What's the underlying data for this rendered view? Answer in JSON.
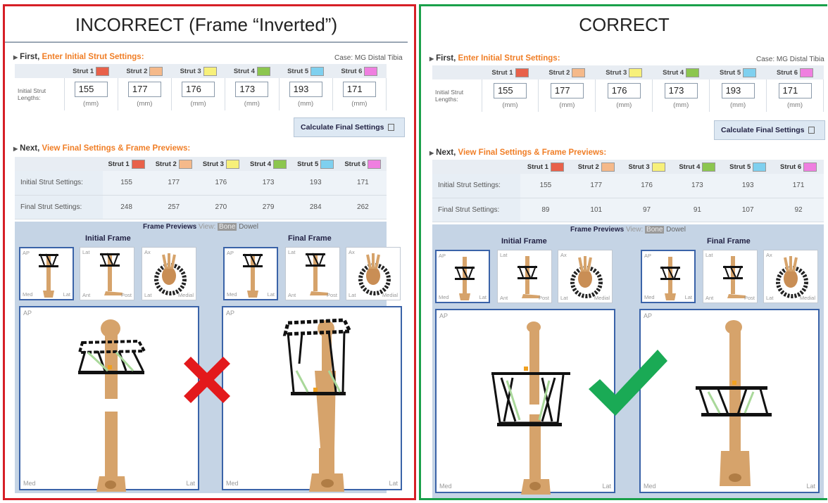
{
  "left": {
    "title": "INCORRECT (Frame “Inverted”)",
    "first_prefix": "First,",
    "first_action": "Enter Initial Strut Settings:",
    "case_label": "Case:",
    "case_value": "MG Distal Tibia",
    "row_label": "Initial Strut Lengths:",
    "struts": [
      {
        "label": "Strut 1",
        "color": "#e8614a",
        "value": "155"
      },
      {
        "label": "Strut 2",
        "color": "#f5b98a",
        "value": "177"
      },
      {
        "label": "Strut 3",
        "color": "#f7f07a",
        "value": "176"
      },
      {
        "label": "Strut 4",
        "color": "#8cc64f",
        "value": "173"
      },
      {
        "label": "Strut 5",
        "color": "#7fd0ef",
        "value": "193"
      },
      {
        "label": "Strut 6",
        "color": "#ef7fe0",
        "value": "171"
      }
    ],
    "unit": "(mm)",
    "calc_button": "Calculate Final Settings",
    "next_prefix": "Next,",
    "next_action": "View Final Settings & Frame Previews:",
    "initial_label": "Initial Strut Settings:",
    "final_label": "Final Strut Settings:",
    "initial_values": [
      "155",
      "177",
      "176",
      "173",
      "193",
      "171"
    ],
    "final_values": [
      "248",
      "257",
      "270",
      "279",
      "284",
      "262"
    ],
    "previews_label": "Frame Previews",
    "view_label": "View:",
    "bone_label": "Bone",
    "dowel_label": "Dowel",
    "initial_frame": "Initial Frame",
    "final_frame": "Final Frame",
    "thumb_tags": [
      "AP",
      "Med",
      "Lat",
      "Lat",
      "Ant",
      "Post",
      "Ax",
      "Lat",
      "Medial"
    ],
    "big_tags": [
      "AP",
      "Med",
      "Lat"
    ],
    "verdict": "cross"
  },
  "right": {
    "title": "CORRECT",
    "first_prefix": "First,",
    "first_action": "Enter Initial Strut Settings:",
    "case_label": "Case:",
    "case_value": "MG Distal Tibia",
    "row_label": "Initial Strut Lengths:",
    "struts": [
      {
        "label": "Strut 1",
        "color": "#e8614a",
        "value": "155"
      },
      {
        "label": "Strut 2",
        "color": "#f5b98a",
        "value": "177"
      },
      {
        "label": "Strut 3",
        "color": "#f7f07a",
        "value": "176"
      },
      {
        "label": "Strut 4",
        "color": "#8cc64f",
        "value": "173"
      },
      {
        "label": "Strut 5",
        "color": "#7fd0ef",
        "value": "193"
      },
      {
        "label": "Strut 6",
        "color": "#ef7fe0",
        "value": "171"
      }
    ],
    "unit": "(mm)",
    "calc_button": "Calculate Final Settings",
    "next_prefix": "Next,",
    "next_action": "View Final Settings & Frame Previews:",
    "initial_label": "Initial Strut Settings:",
    "final_label": "Final Strut Settings:",
    "initial_values": [
      "155",
      "177",
      "176",
      "173",
      "193",
      "171"
    ],
    "final_values": [
      "89",
      "101",
      "97",
      "91",
      "107",
      "92"
    ],
    "previews_label": "Frame Previews",
    "view_label": "View:",
    "bone_label": "Bone",
    "dowel_label": "Dowel",
    "initial_frame": "Initial Frame",
    "final_frame": "Final Frame",
    "thumb_tags": [
      "AP",
      "Med",
      "Lat",
      "Lat",
      "Ant",
      "Post",
      "Ax",
      "Lat",
      "Medial"
    ],
    "big_tags": [
      "AP",
      "Med",
      "Lat"
    ],
    "verdict": "check"
  },
  "colors": {
    "incorrect_border": "#d61f26",
    "correct_border": "#1aa04a",
    "accent_orange": "#f07e26",
    "cross": "#e3191c",
    "check": "#1aaa55",
    "bone": "#d6a36b",
    "strut_green": "#a9d89a"
  }
}
